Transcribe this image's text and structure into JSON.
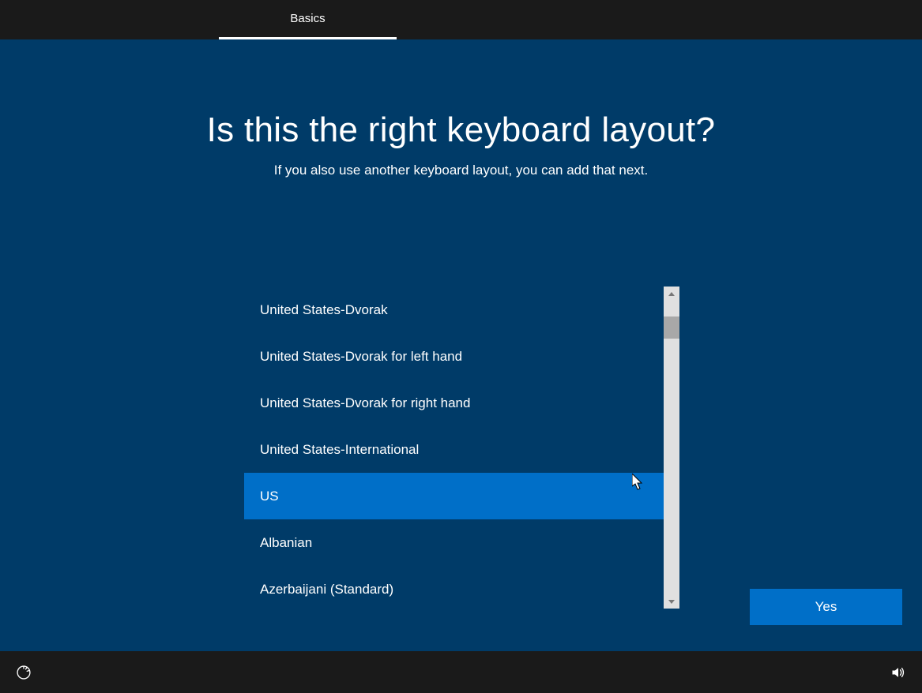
{
  "header": {
    "tab_label": "Basics"
  },
  "main": {
    "heading": "Is this the right keyboard layout?",
    "subheading": "If you also use another keyboard layout, you can add that next.",
    "keyboard_layouts": [
      {
        "label": "United States-Dvorak",
        "selected": false
      },
      {
        "label": "United States-Dvorak for left hand",
        "selected": false
      },
      {
        "label": "United States-Dvorak for right hand",
        "selected": false
      },
      {
        "label": "United States-International",
        "selected": false
      },
      {
        "label": "US",
        "selected": true
      },
      {
        "label": "Albanian",
        "selected": false
      },
      {
        "label": "Azerbaijani (Standard)",
        "selected": false
      }
    ],
    "confirm_button_label": "Yes"
  }
}
